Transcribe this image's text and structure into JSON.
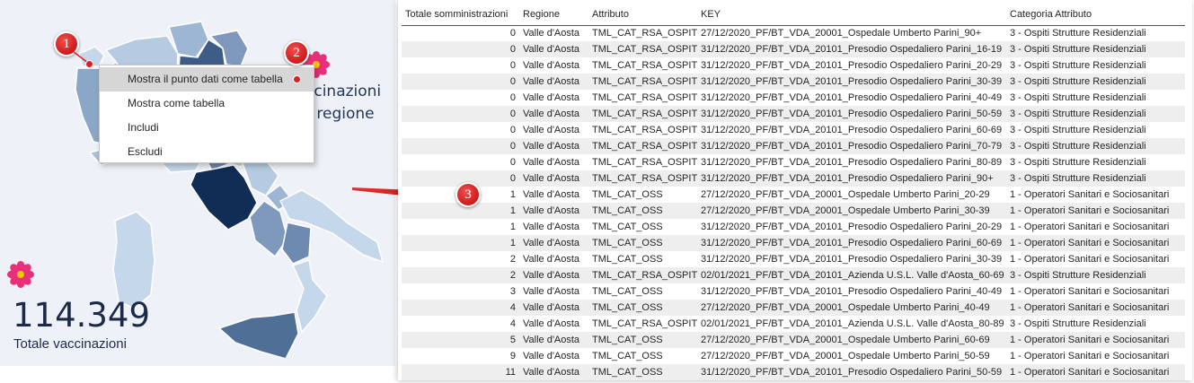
{
  "dashboard": {
    "title_line1": "ccinazioni",
    "title_line2": "r regione",
    "kpi_value": "114.349",
    "kpi_label": "Totale vaccinazioni",
    "colors": {
      "background": "#eef2f8",
      "map_dark": "#0f2d55",
      "map_light": "#c4d6ea",
      "kpi_text": "#1c2a48"
    }
  },
  "context_menu": {
    "items": [
      {
        "label": "Mostra il punto dati come tabella"
      },
      {
        "label": "Mostra come tabella"
      },
      {
        "label": "Includi"
      },
      {
        "label": "Escludi"
      }
    ]
  },
  "callouts": {
    "one": "1",
    "two": "2",
    "three": "3"
  },
  "table": {
    "headers": [
      "Totale somministrazioni",
      "Regione",
      "Attributo",
      "KEY",
      "Categoria Attributo"
    ],
    "rows": [
      [
        "0",
        "Valle d'Aosta",
        "TML_CAT_RSA_OSPITI",
        "27/12/2020_PF/BT_VDA_20001_Ospedale Umberto Parini_90+",
        "3 - Ospiti Strutture Residenziali"
      ],
      [
        "0",
        "Valle d'Aosta",
        "TML_CAT_RSA_OSPITI",
        "31/12/2020_PF/BT_VDA_20101_Presodio Ospedaliero Parini_16-19",
        "3 - Ospiti Strutture Residenziali"
      ],
      [
        "0",
        "Valle d'Aosta",
        "TML_CAT_RSA_OSPITI",
        "31/12/2020_PF/BT_VDA_20101_Presodio Ospedaliero Parini_20-29",
        "3 - Ospiti Strutture Residenziali"
      ],
      [
        "0",
        "Valle d'Aosta",
        "TML_CAT_RSA_OSPITI",
        "31/12/2020_PF/BT_VDA_20101_Presodio Ospedaliero Parini_30-39",
        "3 - Ospiti Strutture Residenziali"
      ],
      [
        "0",
        "Valle d'Aosta",
        "TML_CAT_RSA_OSPITI",
        "31/12/2020_PF/BT_VDA_20101_Presodio Ospedaliero Parini_40-49",
        "3 - Ospiti Strutture Residenziali"
      ],
      [
        "0",
        "Valle d'Aosta",
        "TML_CAT_RSA_OSPITI",
        "31/12/2020_PF/BT_VDA_20101_Presodio Ospedaliero Parini_50-59",
        "3 - Ospiti Strutture Residenziali"
      ],
      [
        "0",
        "Valle d'Aosta",
        "TML_CAT_RSA_OSPITI",
        "31/12/2020_PF/BT_VDA_20101_Presodio Ospedaliero Parini_60-69",
        "3 - Ospiti Strutture Residenziali"
      ],
      [
        "0",
        "Valle d'Aosta",
        "TML_CAT_RSA_OSPITI",
        "31/12/2020_PF/BT_VDA_20101_Presodio Ospedaliero Parini_70-79",
        "3 - Ospiti Strutture Residenziali"
      ],
      [
        "0",
        "Valle d'Aosta",
        "TML_CAT_RSA_OSPITI",
        "31/12/2020_PF/BT_VDA_20101_Presodio Ospedaliero Parini_80-89",
        "3 - Ospiti Strutture Residenziali"
      ],
      [
        "0",
        "Valle d'Aosta",
        "TML_CAT_RSA_OSPITI",
        "31/12/2020_PF/BT_VDA_20101_Presodio Ospedaliero Parini_90+",
        "3 - Ospiti Strutture Residenziali"
      ],
      [
        "1",
        "Valle d'Aosta",
        "TML_CAT_OSS",
        "27/12/2020_PF/BT_VDA_20001_Ospedale Umberto Parini_20-29",
        "1 - Operatori Sanitari e Sociosanitari"
      ],
      [
        "1",
        "Valle d'Aosta",
        "TML_CAT_OSS",
        "27/12/2020_PF/BT_VDA_20001_Ospedale Umberto Parini_30-39",
        "1 - Operatori Sanitari e Sociosanitari"
      ],
      [
        "1",
        "Valle d'Aosta",
        "TML_CAT_OSS",
        "31/12/2020_PF/BT_VDA_20101_Presodio Ospedaliero Parini_20-29",
        "1 - Operatori Sanitari e Sociosanitari"
      ],
      [
        "1",
        "Valle d'Aosta",
        "TML_CAT_OSS",
        "31/12/2020_PF/BT_VDA_20101_Presodio Ospedaliero Parini_60-69",
        "1 - Operatori Sanitari e Sociosanitari"
      ],
      [
        "2",
        "Valle d'Aosta",
        "TML_CAT_OSS",
        "31/12/2020_PF/BT_VDA_20101_Presodio Ospedaliero Parini_30-39",
        "1 - Operatori Sanitari e Sociosanitari"
      ],
      [
        "2",
        "Valle d'Aosta",
        "TML_CAT_RSA_OSPITI",
        "02/01/2021_PF/BT_VDA_20101_Azienda U.S.L. Valle d'Aosta_60-69",
        "3 - Ospiti Strutture Residenziali"
      ],
      [
        "3",
        "Valle d'Aosta",
        "TML_CAT_OSS",
        "31/12/2020_PF/BT_VDA_20101_Presodio Ospedaliero Parini_40-49",
        "1 - Operatori Sanitari e Sociosanitari"
      ],
      [
        "4",
        "Valle d'Aosta",
        "TML_CAT_OSS",
        "27/12/2020_PF/BT_VDA_20001_Ospedale Umberto Parini_40-49",
        "1 - Operatori Sanitari e Sociosanitari"
      ],
      [
        "4",
        "Valle d'Aosta",
        "TML_CAT_RSA_OSPITI",
        "02/01/2021_PF/BT_VDA_20101_Azienda U.S.L. Valle d'Aosta_80-89",
        "3 - Ospiti Strutture Residenziali"
      ],
      [
        "5",
        "Valle d'Aosta",
        "TML_CAT_OSS",
        "27/12/2020_PF/BT_VDA_20001_Ospedale Umberto Parini_60-69",
        "1 - Operatori Sanitari e Sociosanitari"
      ],
      [
        "9",
        "Valle d'Aosta",
        "TML_CAT_OSS",
        "27/12/2020_PF/BT_VDA_20001_Ospedale Umberto Parini_50-59",
        "1 - Operatori Sanitari e Sociosanitari"
      ],
      [
        "11",
        "Valle d'Aosta",
        "TML_CAT_OSS",
        "31/12/2020_PF/BT_VDA_20101_Presodio Ospedaliero Parini_50-59",
        "1 - Operatori Sanitari e Sociosanitari"
      ]
    ]
  }
}
